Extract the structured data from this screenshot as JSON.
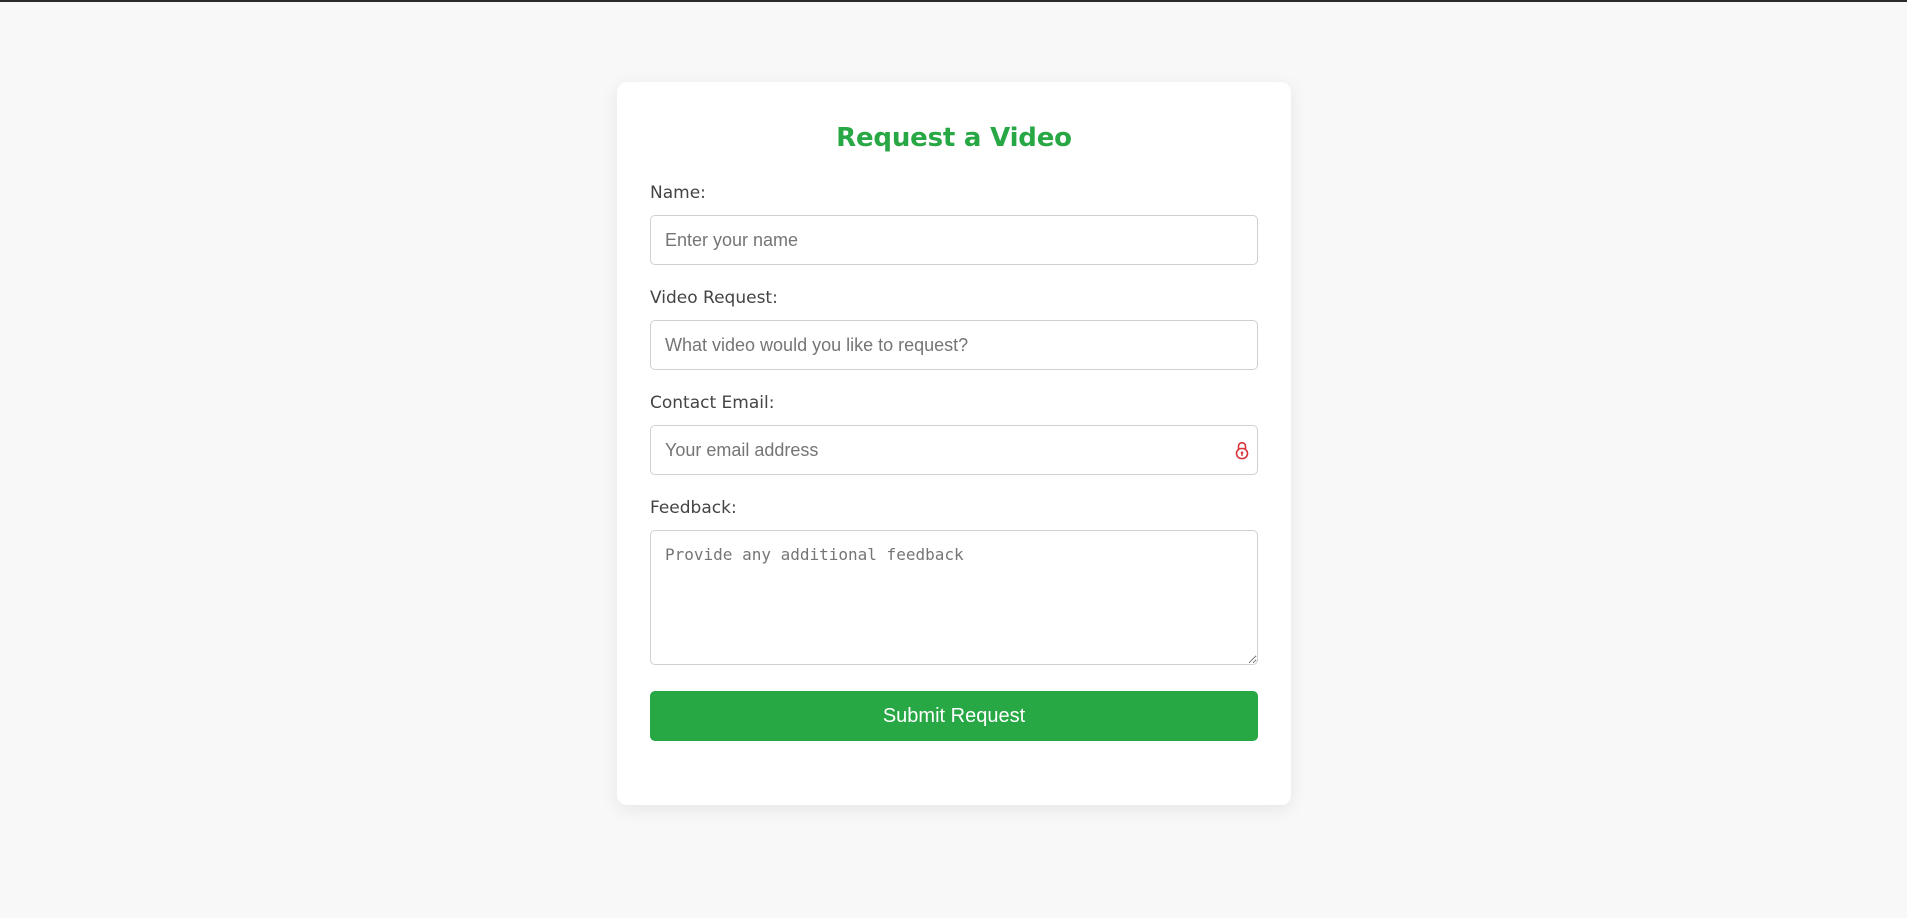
{
  "form": {
    "title": "Request a Video",
    "name": {
      "label": "Name:",
      "value": "",
      "placeholder": "Enter your name"
    },
    "video_request": {
      "label": "Video Request:",
      "value": "",
      "placeholder": "What video would you like to request?"
    },
    "contact_email": {
      "label": "Contact Email:",
      "value": "",
      "placeholder": "Your email address",
      "icon": "lock-icon"
    },
    "feedback": {
      "label": "Feedback:",
      "value": "",
      "placeholder": "Provide any additional feedback"
    },
    "submit_label": "Submit Request"
  },
  "colors": {
    "accent": "#28a745",
    "page_background": "#f8f8f8",
    "card_background": "#ffffff",
    "label_text": "#444444",
    "icon_red": "#d9343a"
  }
}
